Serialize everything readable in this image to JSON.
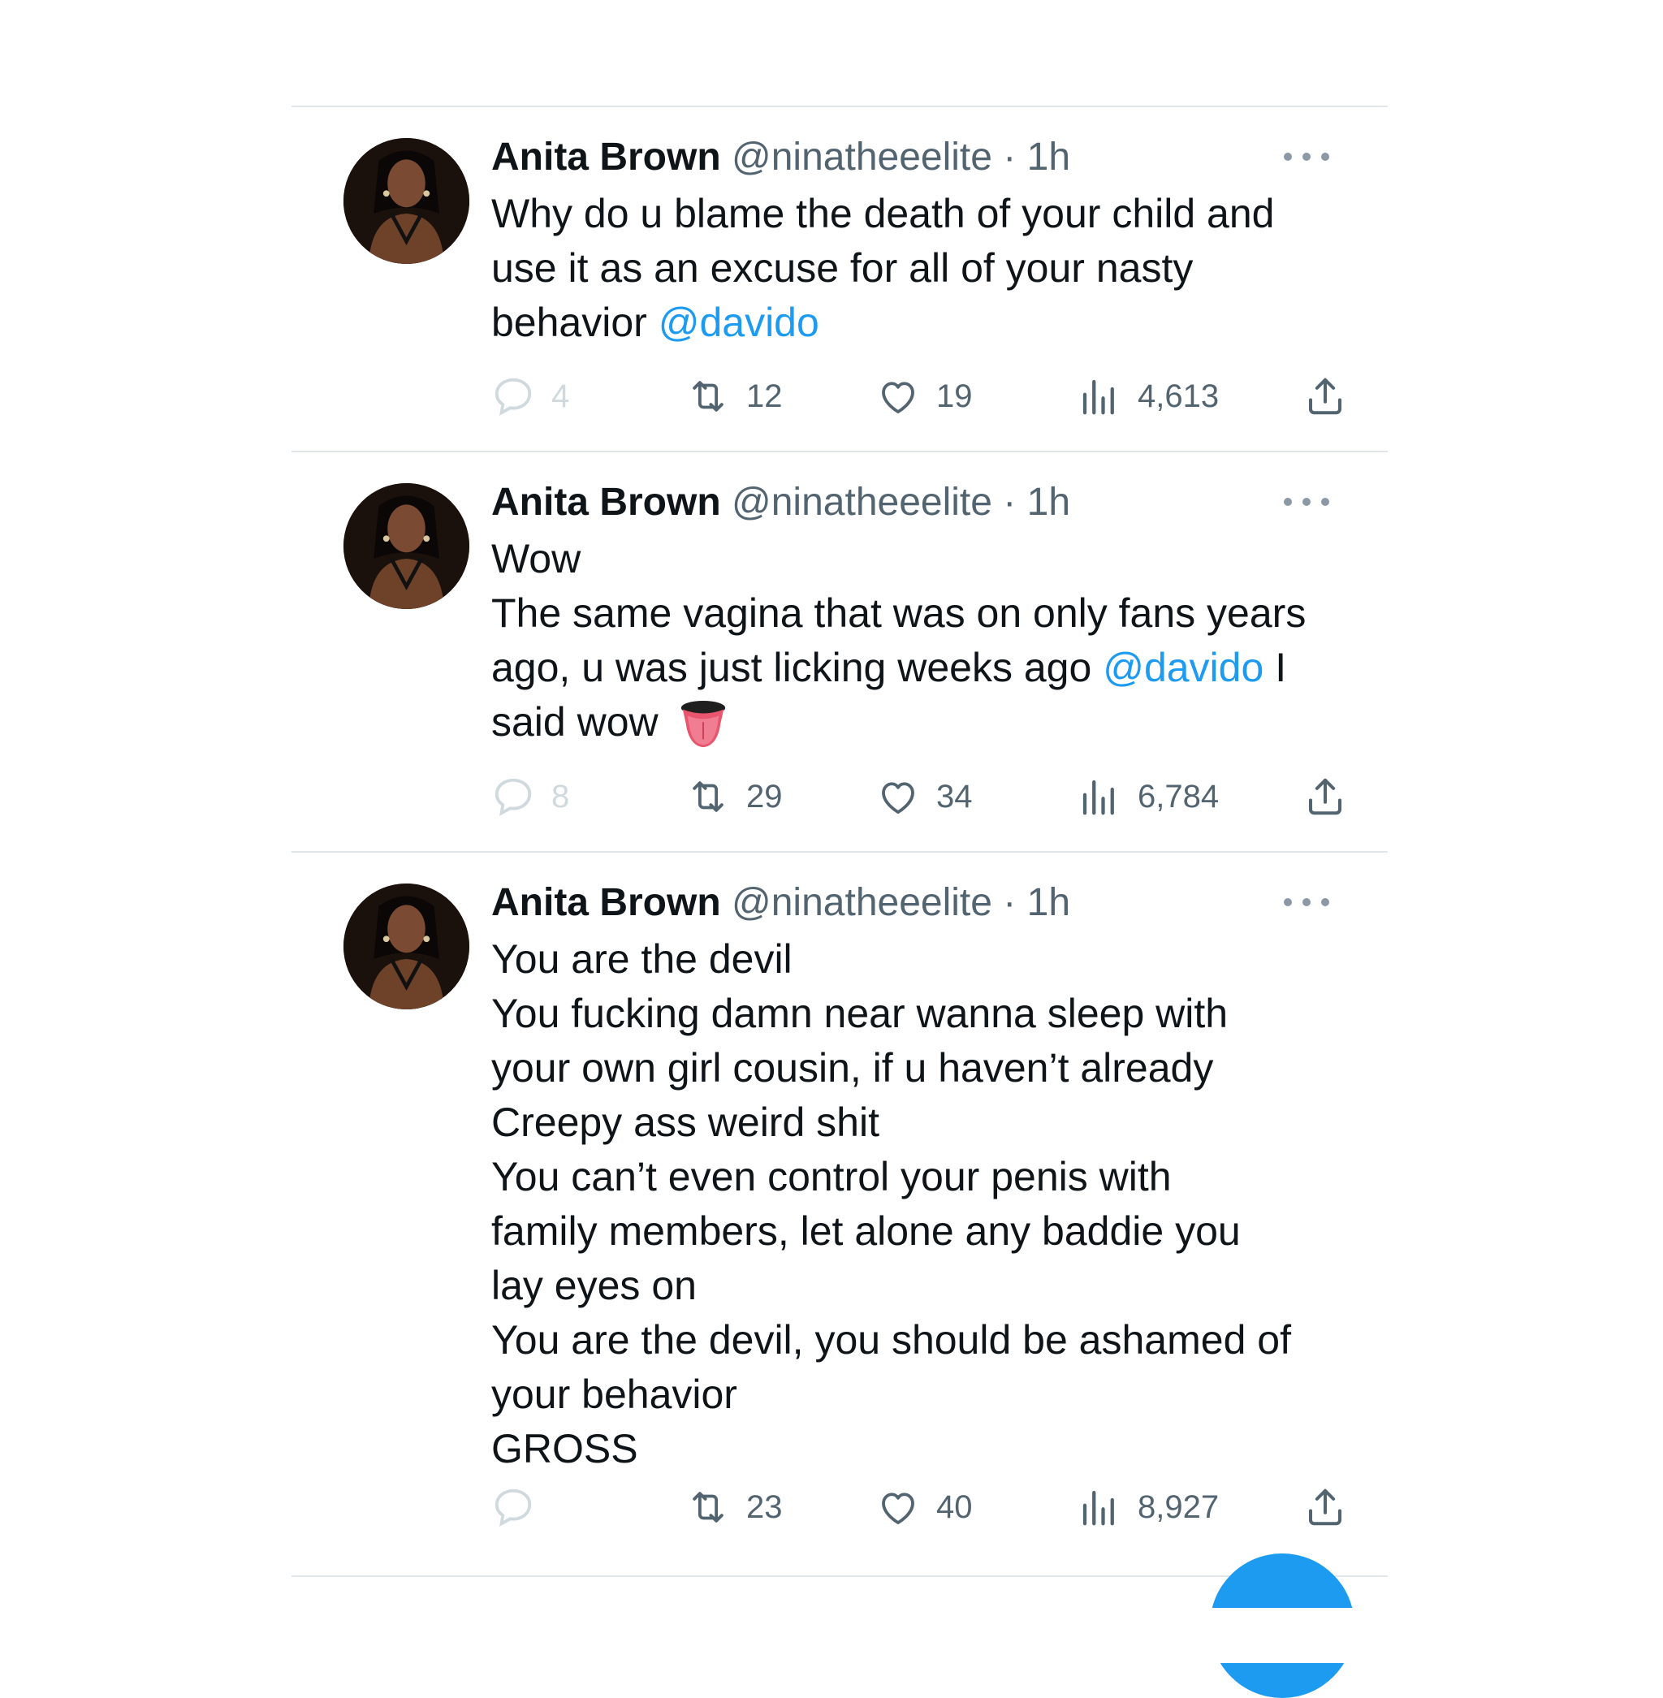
{
  "colors": {
    "accent": "#1d9bf0",
    "text": "#0f1419",
    "muted": "#536471",
    "divider": "#e1e6ea"
  },
  "tweets": [
    {
      "name": "Anita Brown",
      "handle": "@ninatheeelite",
      "dot": "·",
      "time": "1h",
      "lines": [
        [
          "Why do u blame the death of your child and"
        ],
        [
          "use it as an excuse for all of your nasty"
        ],
        [
          "behavior ",
          "@davido"
        ]
      ],
      "stats": {
        "replies": "4",
        "retweets": "12",
        "likes": "19",
        "views": "4,613"
      }
    },
    {
      "name": "Anita Brown",
      "handle": "@ninatheeelite",
      "dot": "·",
      "time": "1h",
      "lines": [
        [
          "Wow"
        ],
        [
          "The same vagina that was on only fans years"
        ],
        [
          "ago, u was just licking weeks ago ",
          "@davido",
          " I"
        ],
        [
          "said wow "
        ]
      ],
      "emoji": "tongue-emoji",
      "stats": {
        "replies": "8",
        "retweets": "29",
        "likes": "34",
        "views": "6,784"
      }
    },
    {
      "name": "Anita Brown",
      "handle": "@ninatheeelite",
      "dot": "·",
      "time": "1h",
      "lines": [
        [
          "You are the devil"
        ],
        [
          "You fucking damn near wanna sleep with"
        ],
        [
          "your own girl cousin, if u haven’t already"
        ],
        [
          "Creepy ass weird shit"
        ],
        [
          "You can’t even control your penis with"
        ],
        [
          "family members, let alone any baddie you"
        ],
        [
          "lay eyes on"
        ],
        [
          "You are the devil, you should be ashamed of"
        ],
        [
          "your behavior"
        ],
        [
          "GROSS"
        ]
      ],
      "stats": {
        "replies": "",
        "retweets": "23",
        "likes": "40",
        "views": "8,927"
      }
    }
  ],
  "icons": {
    "reply": "reply-icon",
    "retweet": "retweet-icon",
    "like": "heart-icon",
    "views": "views-icon",
    "share": "share-icon",
    "more": "more-icon",
    "compose": "compose-fab"
  }
}
